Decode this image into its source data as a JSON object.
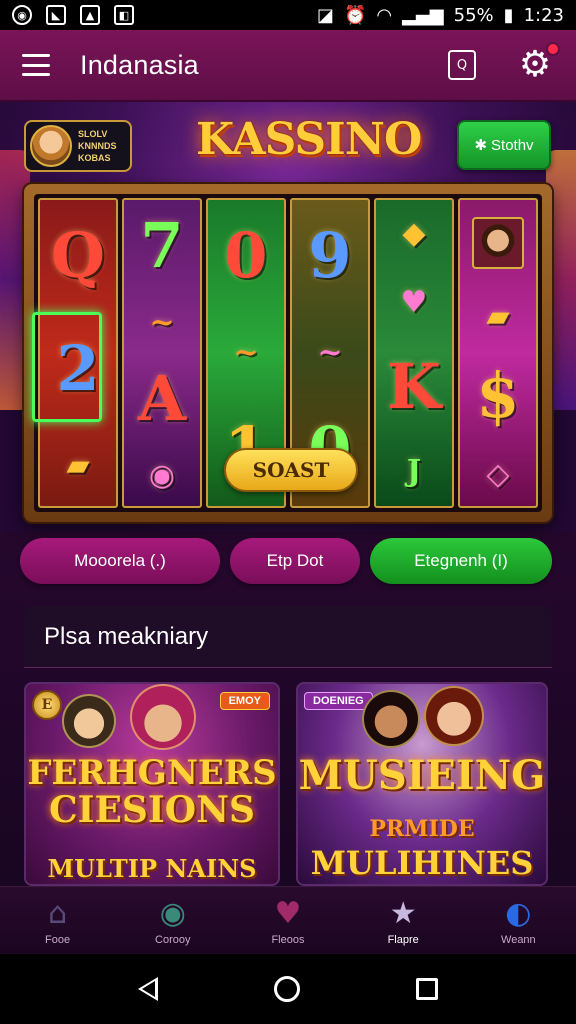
{
  "status_bar": {
    "left_icons": [
      "whatsapp-icon",
      "nfc-icon",
      "gallery-icon",
      "notification-icon"
    ],
    "battery": "55%",
    "time": "1:23"
  },
  "header": {
    "title": "Indanasia"
  },
  "hero": {
    "logo": "KASSINO",
    "profile_lines": [
      "SLOLV",
      "KNNNDS",
      "KOBAS"
    ],
    "cta_label": "Stothv",
    "bonus_label": "SOAST",
    "reels": [
      [
        "Q",
        "2",
        "▰"
      ],
      [
        "7",
        "~",
        "A",
        "◉"
      ],
      [
        "0",
        "~",
        "1"
      ],
      [
        "9",
        "~",
        "0"
      ],
      [
        "◆",
        "♥",
        "K",
        "J"
      ],
      [
        "♔",
        "▰",
        "$",
        "◇"
      ]
    ]
  },
  "tabs": [
    {
      "label": "Mooorela  (.)"
    },
    {
      "label": "Etp Dot"
    },
    {
      "label": "Etegnenh  (I)"
    }
  ],
  "section": {
    "title": "Plsa meakniary"
  },
  "games": [
    {
      "badge": "EMOY",
      "coin": "E",
      "title_line1": "FERHGNERS",
      "title_line2": "CIESIONS",
      "subtitle": "MULTIP NAINS"
    },
    {
      "badge": "DOENIEG",
      "title": "MUSIEING",
      "subtitle_line1": "PRMIDE",
      "subtitle_line2": "MULIHINES"
    }
  ],
  "bottom_nav": [
    {
      "label": "Fooe",
      "icon": "home-icon"
    },
    {
      "label": "Corooy",
      "icon": "chip-icon"
    },
    {
      "label": "Fleoos",
      "icon": "heart-icon"
    },
    {
      "label": "Flapre",
      "icon": "star-icon"
    },
    {
      "label": "Weann",
      "icon": "profile-icon"
    }
  ],
  "colors": {
    "header_bg": "#7a1458",
    "accent_green": "#2cc83a",
    "accent_magenta": "#a61a7a",
    "gold": "#ffcc3a"
  }
}
